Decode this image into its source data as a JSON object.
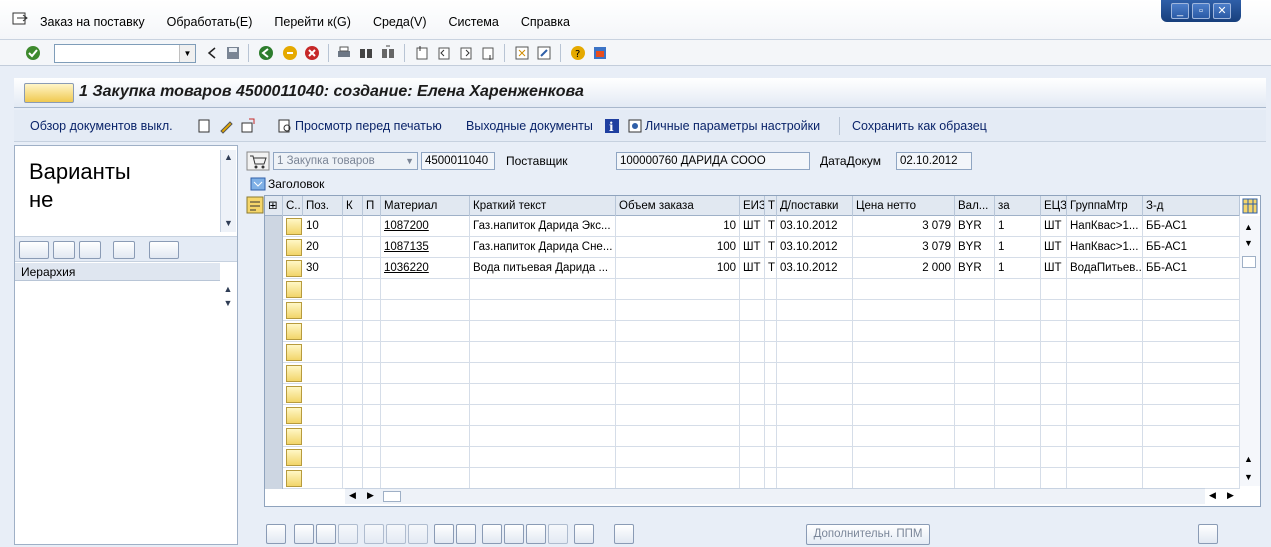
{
  "menu": [
    "Заказ на поставку",
    "Обработать(E)",
    "Перейти к(G)",
    "Среда(V)",
    "Система",
    "Справка"
  ],
  "title": "1 Закупка товаров 4500011040: создание: Елена Харенженкова",
  "appbar": {
    "docs_overview": "Обзор документов выкл.",
    "print_preview": "Просмотр перед печатью",
    "output_docs": "Выходные документы",
    "personal_settings": "Личные параметры настройки",
    "save_as_template": "Сохранить как образец"
  },
  "left": {
    "variants_line1": "Варианты",
    "variants_line2": "не",
    "hierarchy": "Иерархия"
  },
  "header": {
    "doc_type": "1 Закупка товаров",
    "doc_number": "4500011040",
    "vendor_label": "Поставщик",
    "vendor_value": "100000760 ДАРИДА СООО",
    "doc_date_label": "ДатаДокум",
    "doc_date_value": "02.10.2012",
    "header_toggle": "Заголовок"
  },
  "grid": {
    "columns": [
      "С..",
      "Поз.",
      "К",
      "П",
      "Материал",
      "Краткий текст",
      "Объем заказа",
      "ЕИЗ",
      "Т",
      "Д/поставки",
      "Цена нетто",
      "Вал...",
      "за",
      "ЕЦЗ",
      "ГруппаМтр",
      "З-д"
    ],
    "rows": [
      {
        "pos": "10",
        "material": "1087200",
        "text": "Газ.напиток Дарида Экс...",
        "qty": "10",
        "uom": "ШТ",
        "t": "Т",
        "date": "03.10.2012",
        "price": "3 079",
        "cur": "BYR",
        "per": "1",
        "puom": "ШТ",
        "group": "НапКвас>1...",
        "plant": "ББ-АС1"
      },
      {
        "pos": "20",
        "material": "1087135",
        "text": "Газ.напиток Дарида Сне...",
        "qty": "100",
        "uom": "ШТ",
        "t": "Т",
        "date": "03.10.2012",
        "price": "3 079",
        "cur": "BYR",
        "per": "1",
        "puom": "ШТ",
        "group": "НапКвас>1...",
        "plant": "ББ-АС1"
      },
      {
        "pos": "30",
        "material": "1036220",
        "text": "Вода питьевая Дарида ...",
        "qty": "100",
        "uom": "ШТ",
        "t": "Т",
        "date": "03.10.2012",
        "price": "2 000",
        "cur": "BYR",
        "per": "1",
        "puom": "ШТ",
        "group": "ВодаПитьев...",
        "plant": "ББ-АС1"
      }
    ]
  },
  "bottom": {
    "additional_ppm": "Дополнительн. ППМ"
  }
}
